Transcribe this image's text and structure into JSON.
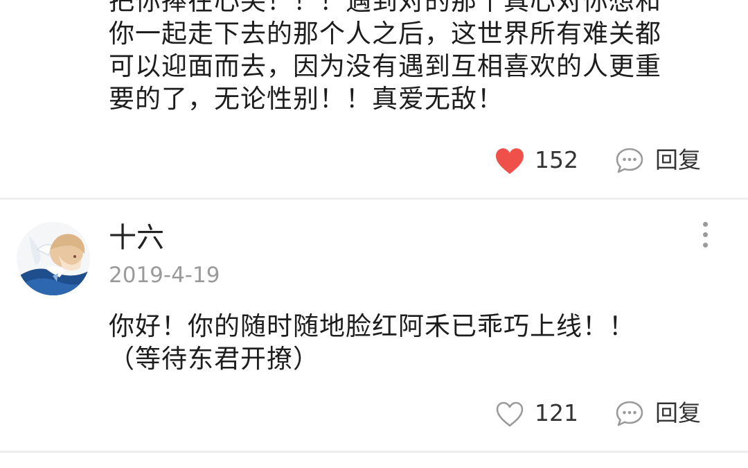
{
  "comments": [
    {
      "text_lines": [
        "把你捧在心尖！！！遇到对的那个真心对你想和",
        "你一起走下去的那个人之后，这世界所有难关都",
        "可以迎面而去，因为没有遇到互相喜欢的人更重",
        "要的了，无论性别！！真爱无敌！"
      ],
      "like_count": "152",
      "liked": true,
      "reply_label": "回复"
    },
    {
      "username": "十六",
      "date": "2019-4-19",
      "text_lines": [
        "你好！你的随时随地脸红阿禾已乖巧上线！！",
        "（等待东君开撩）"
      ],
      "like_count": "121",
      "liked": false,
      "reply_label": "回复"
    }
  ],
  "icons": {
    "like_filled": "heart-filled-icon",
    "like_outline": "heart-outline-icon",
    "reply": "speech-bubble-icon",
    "more": "more-vertical-icon"
  },
  "colors": {
    "like_active": "#f0504a",
    "muted": "#9a9a9a",
    "divider": "#eeeeee"
  }
}
